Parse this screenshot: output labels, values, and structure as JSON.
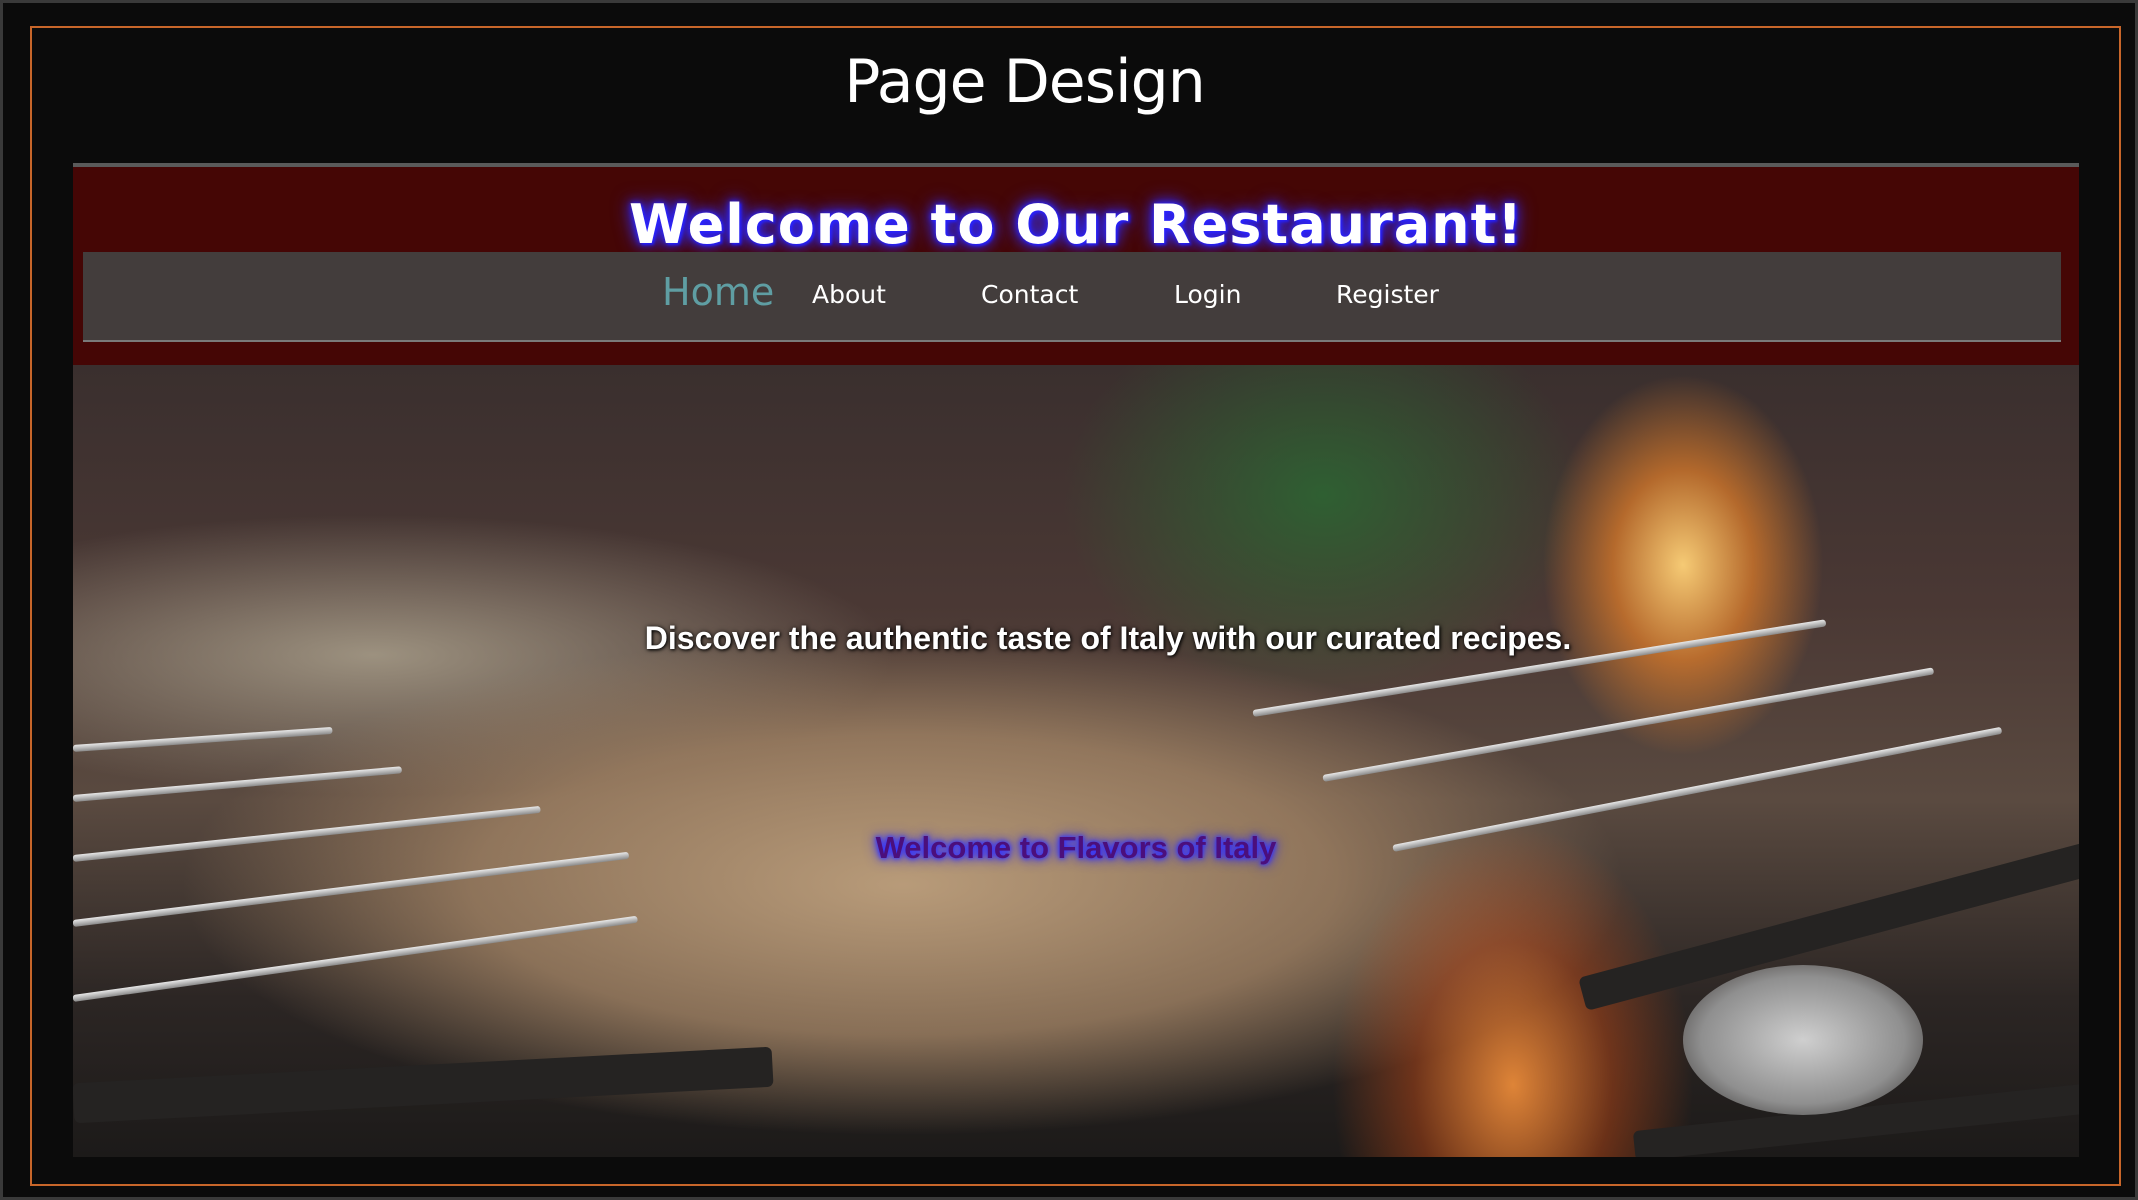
{
  "slide": {
    "title": "Page Design"
  },
  "site": {
    "title": "Welcome to Our Restaurant!",
    "nav": {
      "items": [
        {
          "label": "Home",
          "active": true
        },
        {
          "label": "About",
          "active": false
        },
        {
          "label": "Contact",
          "active": false
        },
        {
          "label": "Login",
          "active": false
        },
        {
          "label": "Register",
          "active": false
        }
      ]
    },
    "hero": {
      "image": "grilled-skewers-over-fire",
      "tagline": "Discover the authentic taste of Italy with our curated recipes.",
      "welcome": "Welcome to Flavors of Italy"
    }
  },
  "colors": {
    "header_background": "#450605",
    "nav_background": "#433d3c",
    "nav_active": "#5f9ea3",
    "title_glow": "#2b24ff",
    "frame_border": "#c8662a"
  }
}
